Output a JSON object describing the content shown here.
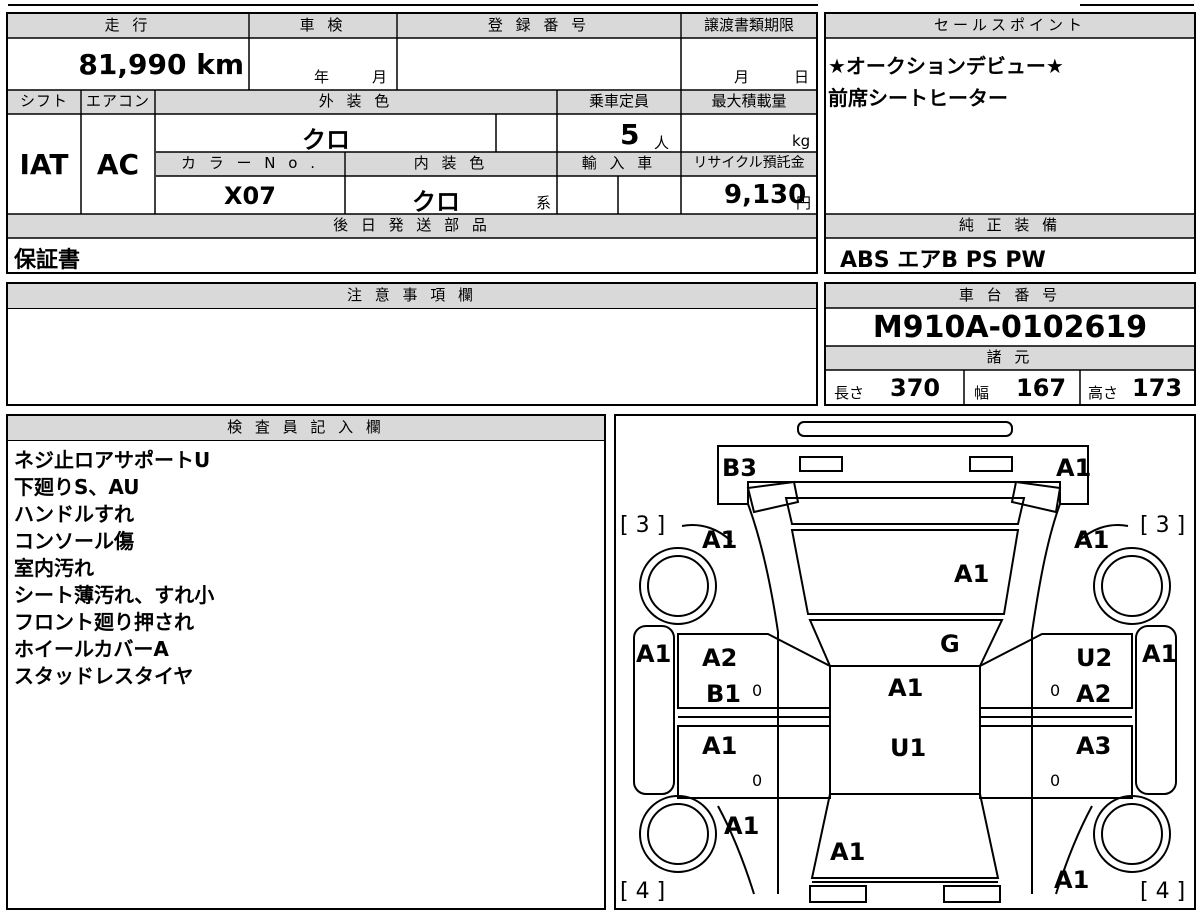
{
  "header": {
    "mileage_label": "走 行",
    "shaken_label": "車 検",
    "reg_label": "登 録 番 号",
    "transfer_label": "譲渡書類期限",
    "sales_label": "セールスポイント"
  },
  "mileage_value": "81,990 km",
  "shaken_year": "年",
  "shaken_month": "月",
  "transfer_month": "月",
  "transfer_day": "日",
  "sales_points": [
    "★オークションデビュー★",
    "前席シートヒーター"
  ],
  "row2": {
    "shift_label": "シフト",
    "ac_label": "エアコン",
    "ext_color_label": "外 装 色",
    "capacity_label": "乗車定員",
    "max_load_label": "最大積載量"
  },
  "shift_value": "IAT",
  "ac_value": "AC",
  "ext_color_value": "クロ",
  "capacity_value": "5",
  "capacity_unit": "人",
  "max_load_unit": "kg",
  "row3": {
    "color_no_label": "カ ラ ー N o .",
    "int_color_label": "内 装 色",
    "import_label": "輸 入 車",
    "recycle_label": "リサイクル預託金"
  },
  "color_no_value": "X07",
  "int_color_value": "クロ",
  "int_color_suffix": "系",
  "recycle_value": "9,130",
  "recycle_unit": "円",
  "later_parts_label": "後 日 発 送 部 品",
  "later_parts_value": "保証書",
  "equipment_label": "純 正 装 備",
  "equipment_value": "ABS エアB PS PW",
  "notes_label": "注 意 事 項 欄",
  "chassis_label": "車 台 番 号",
  "chassis_value": "M910A-0102619",
  "specs_label": "諸 元",
  "specs": {
    "length_label": "長さ",
    "length_value": "370",
    "width_label": "幅",
    "width_value": "167",
    "height_label": "高さ",
    "height_value": "173"
  },
  "inspector_label": "検 査 員 記 入 欄",
  "inspector_notes": [
    "ネジ止ロアサポートU",
    "下廻りS、AU",
    "ハンドルすれ",
    "コンソール傷",
    "室内汚れ",
    "シート薄汚れ、すれ小",
    "フロント廻り押され",
    "ホイールカバーA",
    "スタッドレスタイヤ"
  ],
  "diagram": {
    "front_left_corner": "B3",
    "front_right_corner": "A1",
    "tire_fl_num": "[ 3 ]",
    "tire_fr_num": "[ 3 ]",
    "fender_fl": "A1",
    "fender_fr": "A1",
    "hood": "A1",
    "windshield": "G",
    "side_left": "A1",
    "side_right": "A1",
    "door_fl_top": "A2",
    "door_fl_bottom": "B1",
    "door_fr_top": "U2",
    "door_fr_bottom": "A2",
    "roof": "A1",
    "roof_under": "U1",
    "door_rl": "A1",
    "door_rr": "A3",
    "zero": "0",
    "rear_fender_l": "A1",
    "trunk": "A1",
    "rear_right_corner": "A1",
    "tire_rl_num": "[ 4 ]",
    "tire_rr_num": "[ 4 ]"
  }
}
